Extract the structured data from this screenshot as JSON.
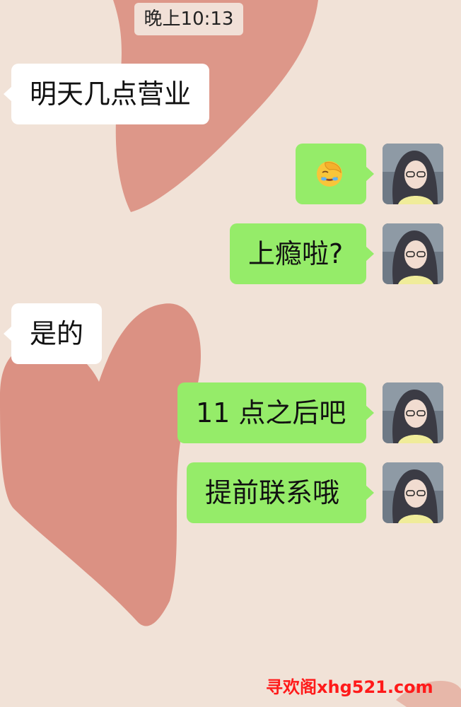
{
  "chat": {
    "timestamp": "晚上10:13",
    "messages": [
      {
        "side": "left",
        "text": "明天几点营业"
      },
      {
        "side": "right",
        "emoji": "face-palm-laughing-emoji"
      },
      {
        "side": "right",
        "text": "上瘾啦?"
      },
      {
        "side": "left",
        "text": "是的"
      },
      {
        "side": "right",
        "text": "11 点之后吧"
      },
      {
        "side": "right",
        "text": "提前联系哦"
      }
    ]
  },
  "watermark": {
    "text": "寻欢阁xhg521.com"
  },
  "colors": {
    "background": "#f1e2d7",
    "heart": "#d98b7c",
    "bubble_right": "#95ec69",
    "bubble_left": "#ffffff",
    "watermark": "#ff1a1a"
  }
}
